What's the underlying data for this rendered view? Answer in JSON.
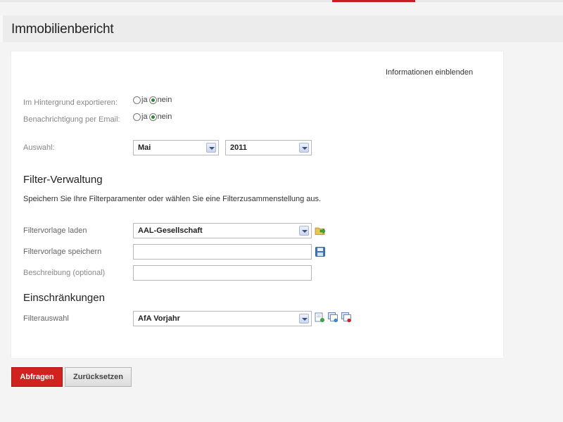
{
  "page": {
    "title": "Immobilienbericht"
  },
  "panel": {
    "info_link": "Informationen einblenden",
    "export_background": {
      "label": "Im Hintergrund exportieren:",
      "options": [
        "ja",
        "nein"
      ],
      "selected": "nein"
    },
    "email_notification": {
      "label": "Benachrichtigung per Email:",
      "options": [
        "ja",
        "nein"
      ],
      "selected": "nein"
    },
    "selection": {
      "label": "Auswahl:",
      "month": "Mai",
      "year": "2011"
    },
    "filter_management": {
      "heading": "Filter-Verwaltung",
      "description": "Speichern Sie Ihre Filterparamenter oder wählen Sie eine Filterzusammenstellung aus.",
      "load_label": "Filtervorlage laden",
      "load_value": "AAL-Gesellschaft",
      "save_label": "Filtervorlage speichern",
      "save_value": "",
      "description_label": "Beschreibung (optional)",
      "description_value": ""
    },
    "restrictions": {
      "heading": "Einschränkungen",
      "filter_label": "Filterauswahl",
      "filter_value": "AfA Vorjahr"
    }
  },
  "buttons": {
    "query": "Abfragen",
    "reset": "Zurücksetzen"
  },
  "colors": {
    "accent_red": "#d0231f",
    "radio_checked": "#2f8a2f"
  }
}
